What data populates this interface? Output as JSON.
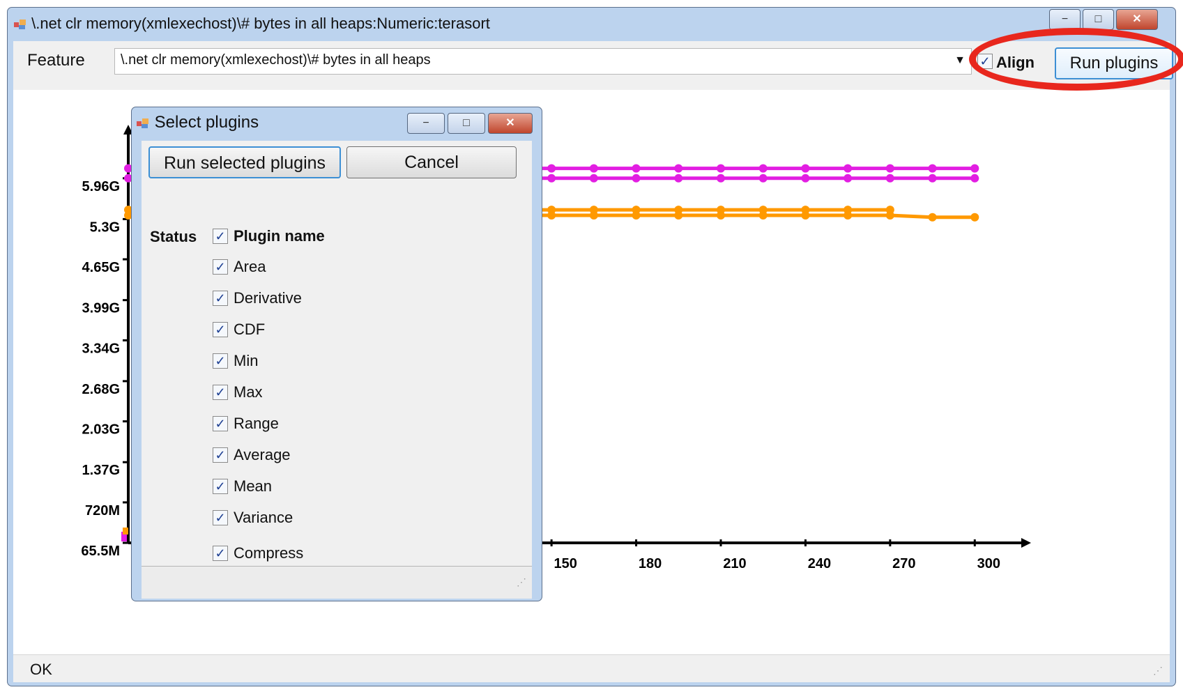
{
  "main_window": {
    "title": "\\.net clr memory(xmlexechost)\\# bytes in all heaps:Numeric:terasort",
    "caption_buttons": {
      "minimize": "−",
      "maximize": "□",
      "close": "✕"
    }
  },
  "toolbar": {
    "feature_label": "Feature",
    "feature_value": "\\.net clr memory(xmlexechost)\\# bytes in all heaps",
    "align_label": "Align",
    "align_checked": true,
    "run_plugins_label": "Run plugins"
  },
  "status_bar": {
    "text": "OK"
  },
  "dialog": {
    "title": "Select plugins",
    "run_selected_label": "Run selected plugins",
    "cancel_label": "Cancel",
    "status_header": "Status",
    "plugin_header": "Plugin name",
    "header_checked": true,
    "plugins": [
      {
        "name": "Area",
        "checked": true
      },
      {
        "name": "Derivative",
        "checked": true
      },
      {
        "name": "CDF",
        "checked": true
      },
      {
        "name": "Min",
        "checked": true
      },
      {
        "name": "Max",
        "checked": true
      },
      {
        "name": "Range",
        "checked": true
      },
      {
        "name": "Average",
        "checked": true
      },
      {
        "name": "Mean",
        "checked": true
      },
      {
        "name": "Variance",
        "checked": true
      },
      {
        "name": "Compress",
        "checked": true
      }
    ]
  },
  "chart_data": {
    "type": "line",
    "y_ticks": [
      "65.5M",
      "720M",
      "1.37G",
      "2.03G",
      "2.68G",
      "3.34G",
      "3.99G",
      "4.65G",
      "5.3G",
      "5.96G"
    ],
    "x_ticks": [
      "150",
      "180",
      "210",
      "240",
      "270",
      "300"
    ],
    "series": [
      {
        "color": "#e21ee2",
        "x": [
          0,
          150,
          165,
          180,
          195,
          210,
          225,
          240,
          255,
          270,
          285,
          300
        ],
        "y": [
          6.12,
          6.12,
          6.12,
          6.12,
          6.12,
          6.12,
          6.12,
          6.12,
          6.12,
          6.12,
          6.12,
          6.12
        ]
      },
      {
        "color": "#e21ee2",
        "x": [
          0,
          150,
          165,
          180,
          195,
          210,
          225,
          240,
          255,
          270,
          285,
          300
        ],
        "y": [
          5.96,
          5.96,
          5.96,
          5.96,
          5.96,
          5.96,
          5.96,
          5.96,
          5.96,
          5.96,
          5.96,
          5.96
        ]
      },
      {
        "color": "#ff9900",
        "x": [
          0,
          150,
          165,
          180,
          195,
          210,
          225,
          240,
          255,
          270
        ],
        "y": [
          5.45,
          5.45,
          5.45,
          5.45,
          5.45,
          5.45,
          5.45,
          5.45,
          5.45,
          5.45
        ]
      },
      {
        "color": "#ff9900",
        "x": [
          0,
          150,
          165,
          180,
          195,
          210,
          225,
          240,
          255,
          270,
          285,
          300
        ],
        "y": [
          5.36,
          5.36,
          5.36,
          5.36,
          5.36,
          5.36,
          5.36,
          5.36,
          5.36,
          5.36,
          5.33,
          5.33
        ]
      }
    ]
  }
}
